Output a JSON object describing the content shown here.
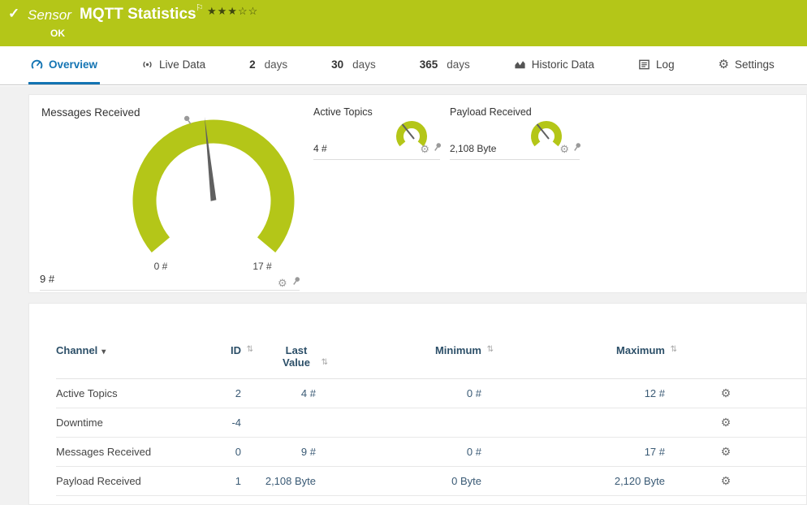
{
  "colors": {
    "brand_green": "#b4c618",
    "accent_blue": "#1374b3",
    "content_bg": "#f1f1f1"
  },
  "header": {
    "check_icon": "✓",
    "type_label": "Sensor",
    "title": "MQTT Statistics",
    "flag_icon": "⚐",
    "rating": "★★★☆☆",
    "status": "OK"
  },
  "tabs": {
    "overview": {
      "label": "Overview"
    },
    "live_data": {
      "label": "Live Data"
    },
    "d2": {
      "num": "2",
      "suffix": "days"
    },
    "d30": {
      "num": "30",
      "suffix": "days"
    },
    "d365": {
      "num": "365",
      "suffix": "days"
    },
    "historic": {
      "label": "Historic Data"
    },
    "log": {
      "label": "Log"
    },
    "settings": {
      "label": "Settings"
    }
  },
  "gauges": {
    "main": {
      "title": "Messages Received",
      "value": "9 #",
      "scale_min": "0 #",
      "scale_max": "17 #"
    },
    "active_topics": {
      "title": "Active Topics",
      "value": "4 #"
    },
    "payload": {
      "title": "Payload Received",
      "value": "2,108 Byte"
    }
  },
  "icons": {
    "gear": "⚙",
    "sort": "⇅",
    "sort_active": "▾"
  },
  "table": {
    "columns": {
      "channel": "Channel",
      "id": "ID",
      "last_value": "Last Value",
      "minimum": "Minimum",
      "maximum": "Maximum"
    },
    "rows": [
      {
        "channel": "Active Topics",
        "id": "2",
        "last_value": "4 #",
        "minimum": "0 #",
        "maximum": "12 #"
      },
      {
        "channel": "Downtime",
        "id": "-4",
        "last_value": "",
        "minimum": "",
        "maximum": ""
      },
      {
        "channel": "Messages Received",
        "id": "0",
        "last_value": "9 #",
        "minimum": "0 #",
        "maximum": "17 #"
      },
      {
        "channel": "Payload Received",
        "id": "1",
        "last_value": "2,108 Byte",
        "minimum": "0 Byte",
        "maximum": "2,120 Byte"
      }
    ]
  }
}
